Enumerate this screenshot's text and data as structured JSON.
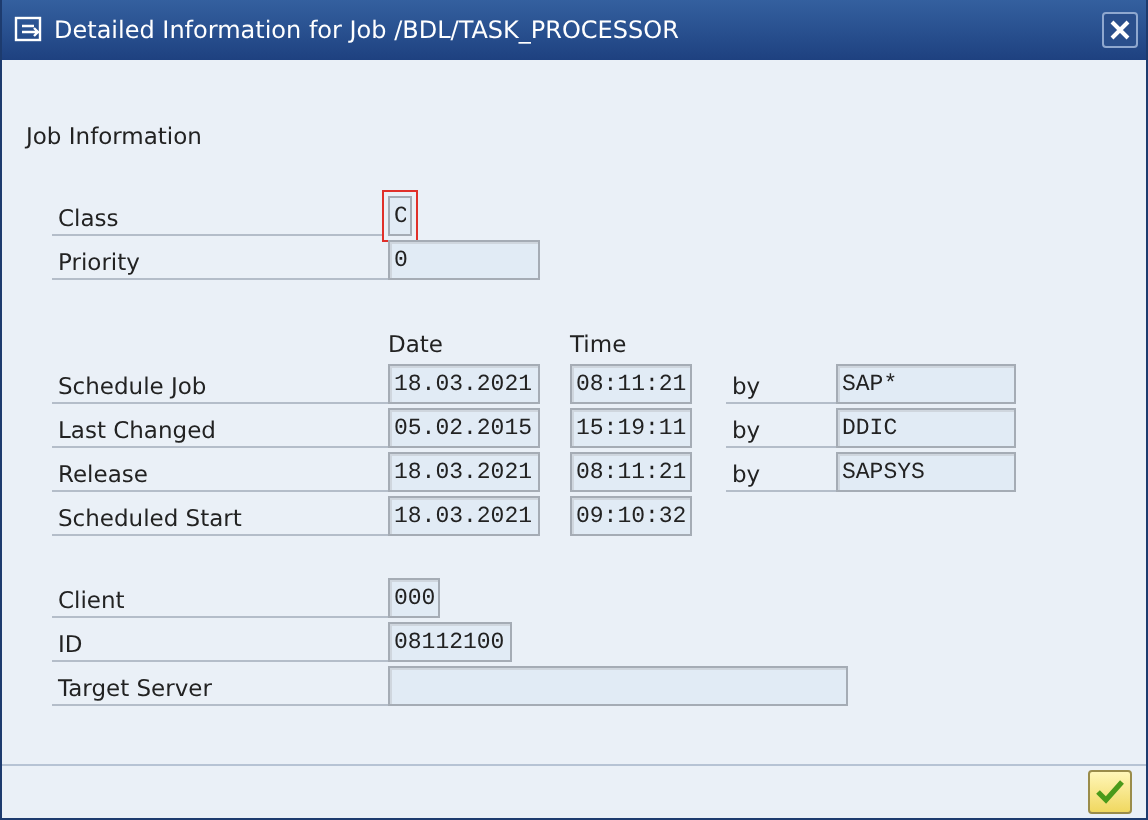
{
  "window": {
    "title": "Detailed Information for Job /BDL/TASK_PROCESSOR"
  },
  "section_title": "Job Information",
  "top_fields": [
    {
      "label": "Class",
      "value": "C",
      "focused": true
    },
    {
      "label": "Priority",
      "value": "0",
      "focused": false
    }
  ],
  "schedule": {
    "columns": [
      "Date",
      "Time"
    ],
    "rows": [
      {
        "label": "Schedule Job",
        "date": "18.03.2021",
        "time": "08:11:21",
        "by_label": "by",
        "user": "SAP*"
      },
      {
        "label": "Last Changed",
        "date": "05.02.2015",
        "time": "15:19:11",
        "by_label": "by",
        "user": "DDIC"
      },
      {
        "label": "Release",
        "date": "18.03.2021",
        "time": "08:11:21",
        "by_label": "by",
        "user": "SAPSYS"
      },
      {
        "label": "Scheduled Start",
        "date": "18.03.2021",
        "time": "09:10:32"
      }
    ]
  },
  "bottom_fields": [
    {
      "label": "Client",
      "value": "000",
      "focused": false
    },
    {
      "label": "ID",
      "value": "08112100",
      "focused": false
    },
    {
      "label": "Target Server",
      "focused": false
    }
  ]
}
